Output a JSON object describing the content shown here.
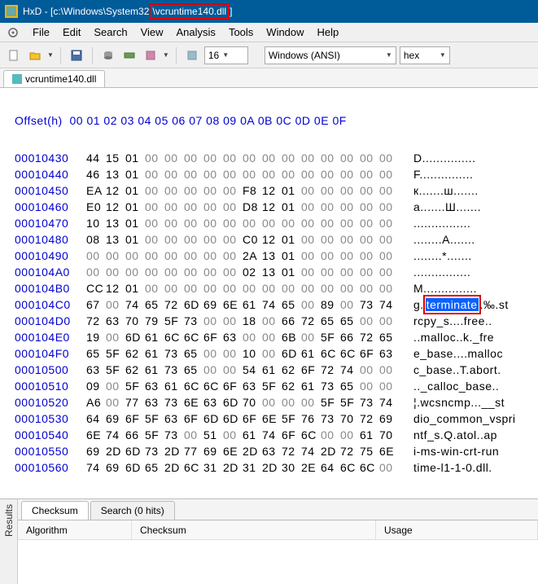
{
  "title_prefix": "HxD - [c:\\Windows\\System32",
  "title_hl": "\\vcruntime140.dll",
  "title_suffix": "]",
  "menu": [
    "File",
    "Edit",
    "Search",
    "View",
    "Analysis",
    "Tools",
    "Window",
    "Help"
  ],
  "toolbar": {
    "bytes_per_row": "16",
    "encoding": "Windows (ANSI)",
    "base": "hex"
  },
  "tab_label": "vcruntime140.dll",
  "offset_header": "Offset(h)  00 01 02 03 04 05 06 07 08 09 0A 0B 0C 0D 0E 0F",
  "rows": [
    {
      "a": "00010430",
      "h": [
        "44",
        "15",
        "01",
        "00",
        "00",
        "00",
        "00",
        "00",
        "00",
        "00",
        "00",
        "00",
        "00",
        "00",
        "00",
        "00"
      ],
      "t": "D..............."
    },
    {
      "a": "00010440",
      "h": [
        "46",
        "13",
        "01",
        "00",
        "00",
        "00",
        "00",
        "00",
        "00",
        "00",
        "00",
        "00",
        "00",
        "00",
        "00",
        "00"
      ],
      "t": "F..............."
    },
    {
      "a": "00010450",
      "h": [
        "EA",
        "12",
        "01",
        "00",
        "00",
        "00",
        "00",
        "00",
        "F8",
        "12",
        "01",
        "00",
        "00",
        "00",
        "00",
        "00"
      ],
      "t": "к.......ш......."
    },
    {
      "a": "00010460",
      "h": [
        "E0",
        "12",
        "01",
        "00",
        "00",
        "00",
        "00",
        "00",
        "D8",
        "12",
        "01",
        "00",
        "00",
        "00",
        "00",
        "00"
      ],
      "t": "а.......Ш......."
    },
    {
      "a": "00010470",
      "h": [
        "10",
        "13",
        "01",
        "00",
        "00",
        "00",
        "00",
        "00",
        "00",
        "00",
        "00",
        "00",
        "00",
        "00",
        "00",
        "00"
      ],
      "t": "................"
    },
    {
      "a": "00010480",
      "h": [
        "08",
        "13",
        "01",
        "00",
        "00",
        "00",
        "00",
        "00",
        "C0",
        "12",
        "01",
        "00",
        "00",
        "00",
        "00",
        "00"
      ],
      "t": "........А......."
    },
    {
      "a": "00010490",
      "h": [
        "00",
        "00",
        "00",
        "00",
        "00",
        "00",
        "00",
        "00",
        "2A",
        "13",
        "01",
        "00",
        "00",
        "00",
        "00",
        "00"
      ],
      "t": "........*......."
    },
    {
      "a": "000104A0",
      "h": [
        "00",
        "00",
        "00",
        "00",
        "00",
        "00",
        "00",
        "00",
        "02",
        "13",
        "01",
        "00",
        "00",
        "00",
        "00",
        "00"
      ],
      "t": "................"
    },
    {
      "a": "000104B0",
      "h": [
        "CC",
        "12",
        "01",
        "00",
        "00",
        "00",
        "00",
        "00",
        "00",
        "00",
        "00",
        "00",
        "00",
        "00",
        "00",
        "00"
      ],
      "t": "М..............."
    },
    {
      "a": "000104C0",
      "h": [
        "67",
        "00",
        "74",
        "65",
        "72",
        "6D",
        "69",
        "6E",
        "61",
        "74",
        "65",
        "00",
        "89",
        "00",
        "73",
        "74"
      ],
      "t": "g.",
      "hl": true,
      "hl_text": "terminate",
      "t2": ".‰.st"
    },
    {
      "a": "000104D0",
      "h": [
        "72",
        "63",
        "70",
        "79",
        "5F",
        "73",
        "00",
        "00",
        "18",
        "00",
        "66",
        "72",
        "65",
        "65",
        "00",
        "00"
      ],
      "t": "rcpy_s....free.."
    },
    {
      "a": "000104E0",
      "h": [
        "19",
        "00",
        "6D",
        "61",
        "6C",
        "6C",
        "6F",
        "63",
        "00",
        "00",
        "6B",
        "00",
        "5F",
        "66",
        "72",
        "65"
      ],
      "t": "..malloc..k._fre"
    },
    {
      "a": "000104F0",
      "h": [
        "65",
        "5F",
        "62",
        "61",
        "73",
        "65",
        "00",
        "00",
        "10",
        "00",
        "6D",
        "61",
        "6C",
        "6C",
        "6F",
        "63"
      ],
      "t": "e_base....malloc"
    },
    {
      "a": "00010500",
      "h": [
        "63",
        "5F",
        "62",
        "61",
        "73",
        "65",
        "00",
        "00",
        "54",
        "61",
        "62",
        "6F",
        "72",
        "74",
        "00",
        "00"
      ],
      "t": "c_base..T.abort."
    },
    {
      "a": "00010510",
      "h": [
        "09",
        "00",
        "5F",
        "63",
        "61",
        "6C",
        "6C",
        "6F",
        "63",
        "5F",
        "62",
        "61",
        "73",
        "65",
        "00",
        "00"
      ],
      "t": ".._calloc_base.."
    },
    {
      "a": "00010520",
      "h": [
        "A6",
        "00",
        "77",
        "63",
        "73",
        "6E",
        "63",
        "6D",
        "70",
        "00",
        "00",
        "00",
        "5F",
        "5F",
        "73",
        "74"
      ],
      "t": "¦.wcsncmp...__st"
    },
    {
      "a": "00010530",
      "h": [
        "64",
        "69",
        "6F",
        "5F",
        "63",
        "6F",
        "6D",
        "6D",
        "6F",
        "6E",
        "5F",
        "76",
        "73",
        "70",
        "72",
        "69"
      ],
      "t": "dio_common_vspri"
    },
    {
      "a": "00010540",
      "h": [
        "6E",
        "74",
        "66",
        "5F",
        "73",
        "00",
        "51",
        "00",
        "61",
        "74",
        "6F",
        "6C",
        "00",
        "00",
        "61",
        "70"
      ],
      "t": "ntf_s.Q.atol..ap"
    },
    {
      "a": "00010550",
      "h": [
        "69",
        "2D",
        "6D",
        "73",
        "2D",
        "77",
        "69",
        "6E",
        "2D",
        "63",
        "72",
        "74",
        "2D",
        "72",
        "75",
        "6E"
      ],
      "t": "i-ms-win-crt-run"
    },
    {
      "a": "00010560",
      "h": [
        "74",
        "69",
        "6D",
        "65",
        "2D",
        "6C",
        "31",
        "2D",
        "31",
        "2D",
        "30",
        "2E",
        "64",
        "6C",
        "6C",
        "00"
      ],
      "t": "time-l1-1-0.dll."
    }
  ],
  "results": {
    "side_label": "Results",
    "tabs": [
      "Checksum",
      "Search (0 hits)"
    ],
    "columns": [
      "Algorithm",
      "Checksum",
      "Usage"
    ]
  }
}
